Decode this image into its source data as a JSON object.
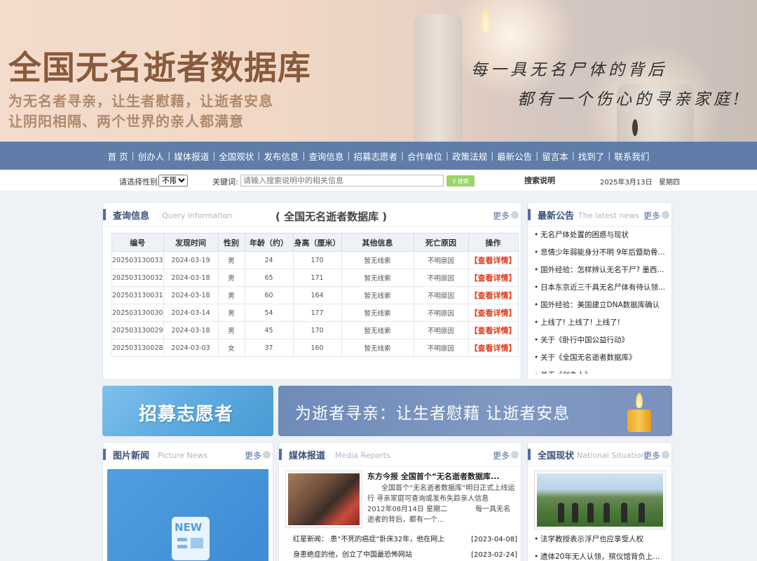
{
  "banner": {
    "title": "全国无名逝者数据库",
    "slogan_line1": "为无名者寻亲，让生者慰藉，让逝者安息",
    "slogan_line2": "让阴阳相隔、两个世界的亲人都满意",
    "poem_line1": "每一具无名尸体的背后",
    "poem_line2": "都有一个伤心的寻亲家庭!"
  },
  "nav": {
    "items": [
      "首 页",
      "创办人",
      "媒体报道",
      "全国观状",
      "发布信息",
      "查询信息",
      "招募志愿者",
      "合作单位",
      "政策法规",
      "最新公告",
      "留言本",
      "找到了",
      "联系我们"
    ],
    "separator": "|"
  },
  "search": {
    "gender_label": "请选择性别",
    "gender_selected": "不限",
    "keyword_label": "关键词:",
    "keyword_placeholder": "请输入搜索说明中的相关信息",
    "button_label": "搜索",
    "help_label": "搜索说明",
    "date": "2025年3月13日",
    "weekday": "星期四"
  },
  "query": {
    "title_cn": "查询信息",
    "title_en": "Query information",
    "center_title": "( 全国无名逝者数据库 )",
    "more": "更多",
    "columns": [
      "编号",
      "发现时间",
      "性别",
      "年龄（约）",
      "身高（厘米）",
      "其他信息",
      "死亡原因",
      "操作"
    ],
    "rows": [
      [
        "202503130033",
        "2024-03-19",
        "男",
        "24",
        "170",
        "暂无线索",
        "不明原因",
        "【查看详情】"
      ],
      [
        "202503130032",
        "2024-03-18",
        "男",
        "65",
        "171",
        "暂无线索",
        "不明原因",
        "【查看详情】"
      ],
      [
        "202503130031",
        "2024-03-18",
        "男",
        "60",
        "164",
        "暂无线索",
        "不明原因",
        "【查看详情】"
      ],
      [
        "202503130030",
        "2024-03-14",
        "男",
        "54",
        "177",
        "暂无线索",
        "不明原因",
        "【查看详情】"
      ],
      [
        "202503130029",
        "2024-03-18",
        "男",
        "45",
        "170",
        "暂无线索",
        "不明原因",
        "【查看详情】"
      ],
      [
        "202503130028",
        "2024-03-03",
        "女",
        "37",
        "160",
        "暂无线索",
        "不明原因",
        "【查看详情】"
      ]
    ]
  },
  "notices": {
    "title_cn": "最新公告",
    "title_en": "The latest news",
    "more": "更多",
    "items": [
      "无名尸体处置的困惑与现状",
      "悲情少年弱能身分不明 9年后暨助骨...",
      "国外经验：怎样辨认无名干尸? 墨西...",
      "日本东京近三千具无名尸体有待认领...",
      "国外经验：美国建立DNA数据库确认",
      "上线了! 上线了! 上线了!",
      "关于《卧行中国公益行动》",
      "关于《全国无名逝者数据库》",
      "关于《创办人》"
    ]
  },
  "promo": {
    "left_text": "招募志愿者",
    "right_text": "为逝者寻亲：让生者慰藉 让逝者安息"
  },
  "picture_news": {
    "title_cn": "图片新闻",
    "title_en": "Picture News",
    "more": "更多",
    "badge": "NEW"
  },
  "media": {
    "title_cn": "媒体报道",
    "title_en": "Media Reports",
    "more": "更多",
    "headline": "东方今报  全国首个“无名逝者数据库...",
    "summary": "　　全国首个“无名逝者数据库”明日正式上线运行  寻亲家庭可查询或发布失踪亲人信息　　2012年08月14日 星期二　　　　每一具无名逝者的背后，都有一个...",
    "list": [
      {
        "title": "红星新闻：  患“不死的癌症”卧床32年，他在网上",
        "date": "[2023-04-08]"
      },
      {
        "title": "身患绝症的他，创立了中国最恐怖网站",
        "date": "[2023-02-24]"
      }
    ]
  },
  "national": {
    "title_cn": "全国现状",
    "title_en": "National Situation",
    "more": "更多",
    "list": [
      "法学教授表示浮尸也应享受人权",
      "遗体20年无人认领，殡仪馆背负上..."
    ]
  }
}
